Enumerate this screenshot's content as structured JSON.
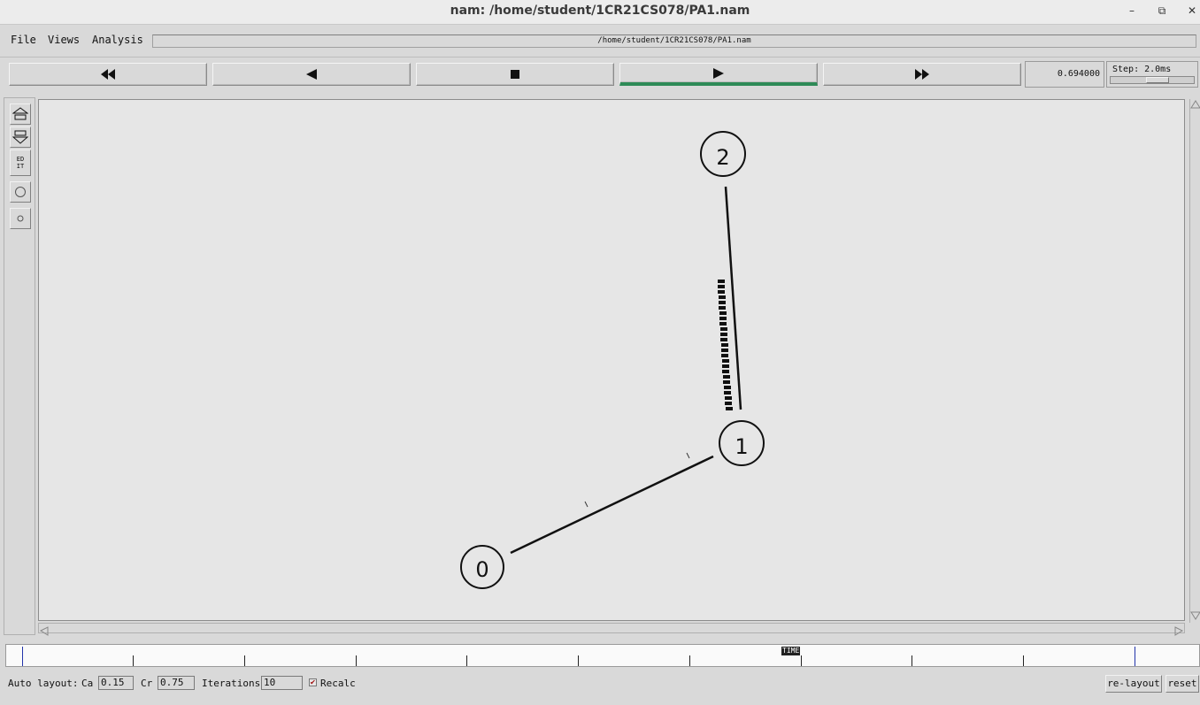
{
  "window": {
    "title": "nam: /home/student/1CR21CS078/PA1.nam",
    "minimize": "–",
    "maximize": "⧉",
    "close": "✕"
  },
  "menu": {
    "file": "File",
    "views": "Views",
    "analysis": "Analysis",
    "path": "/home/student/1CR21CS078/PA1.nam"
  },
  "controls": {
    "rewind_icon": "⏪-icon",
    "back_icon": "back-icon",
    "stop_icon": "stop-icon",
    "play_icon": "play-icon",
    "ff_icon": "fast-forward-icon",
    "time": "0.694000",
    "step": "Step: 2.0ms"
  },
  "tools": {
    "edit": "ED\nIT"
  },
  "network": {
    "nodes": [
      "0",
      "1",
      "2"
    ]
  },
  "timeline": {
    "label": "TIME"
  },
  "bottom": {
    "auto_layout": "Auto layout:",
    "ca_label": "Ca",
    "ca_value": "0.15",
    "cr_label": "Cr",
    "cr_value": "0.75",
    "iterations_label": "Iterations",
    "iterations_value": "10",
    "recalc_label": "Recalc",
    "relayout": "re-layout",
    "reset": "reset"
  },
  "colors": {
    "play_indicator": "#2e8b57",
    "canvas_bg": "#e6e6e6"
  }
}
